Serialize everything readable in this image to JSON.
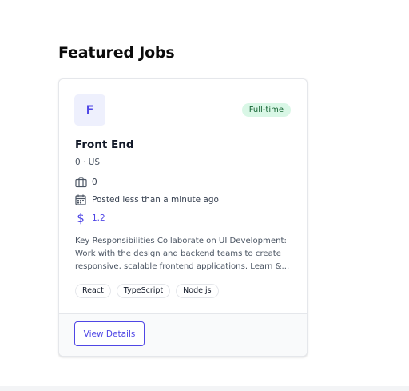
{
  "section": {
    "title": "Featured Jobs"
  },
  "job": {
    "logo_letter": "F",
    "employment_type": "Full-time",
    "title": "Front End",
    "location": "0 · US",
    "experience": "0",
    "posted": "Posted less than a minute ago",
    "salary_symbol": "$",
    "salary": "1.2",
    "description": "Key Responsibilities Collaborate on UI Development: Work with the design and backend teams to create responsive, scalable frontend applications. Learn &...",
    "tags": [
      "React",
      "TypeScript",
      "Node.js"
    ],
    "cta_label": "View Details"
  },
  "colors": {
    "accent": "#4f46e5",
    "badge_bg": "#d9f7e6",
    "badge_text": "#166534",
    "logo_bg": "#eef0fd"
  },
  "icons": {
    "experience": "briefcase-icon",
    "posted": "calendar-icon",
    "salary": "dollar-icon"
  }
}
